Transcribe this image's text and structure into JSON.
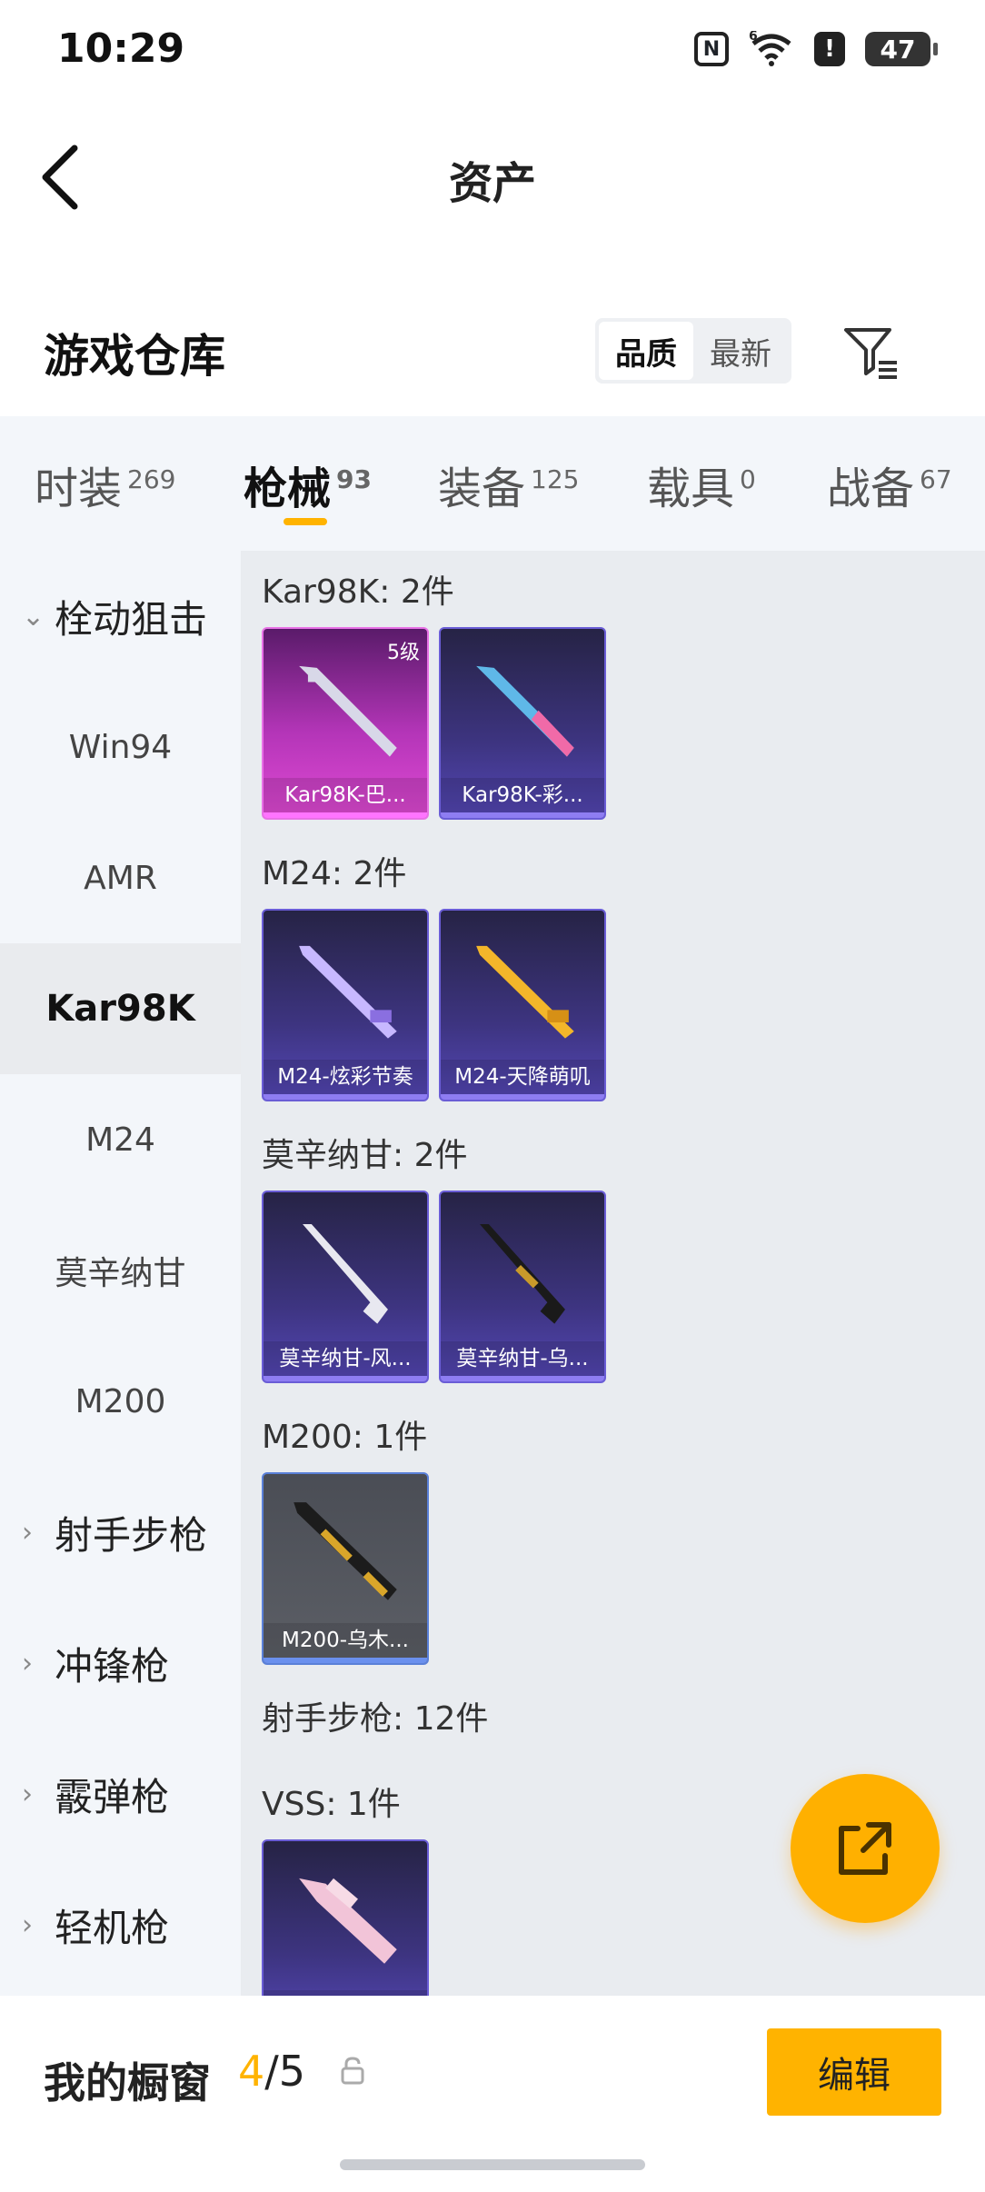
{
  "status_bar": {
    "time": "10:29",
    "network": "6",
    "battery": "47"
  },
  "header": {
    "title": "资产"
  },
  "warehouse": {
    "title": "游戏仓库",
    "sort_options": [
      "品质",
      "最新"
    ],
    "selected_sort": "品质"
  },
  "category_tabs": [
    {
      "label": "时装",
      "count": "269"
    },
    {
      "label": "枪械",
      "count": "93"
    },
    {
      "label": "装备",
      "count": "125"
    },
    {
      "label": "载具",
      "count": "0"
    },
    {
      "label": "战备",
      "count": "67"
    }
  ],
  "active_tab": "枪械",
  "sidebar": {
    "group_sniper": "栓动狙击",
    "items": [
      "Win94",
      "AMR",
      "Kar98K",
      "M24",
      "莫辛纳甘",
      "M200"
    ],
    "active_item": "Kar98K",
    "groups": [
      "射手步枪",
      "冲锋枪",
      "霰弹枪",
      "轻机枪"
    ]
  },
  "sections": [
    {
      "title": "Kar98K: 2件",
      "items": [
        {
          "name": "Kar98K-巴...",
          "badge": "5级",
          "rarity": "pink",
          "gun_color": "#d8d8e8"
        },
        {
          "name": "Kar98K-彩...",
          "badge": "",
          "rarity": "purple",
          "gun_color": "#5fb8e8"
        }
      ]
    },
    {
      "title": "M24: 2件",
      "items": [
        {
          "name": "M24-炫彩节奏",
          "badge": "",
          "rarity": "purple",
          "gun_color": "#c7b8ff"
        },
        {
          "name": "M24-天降萌叽",
          "badge": "",
          "rarity": "purple",
          "gun_color": "#f3b62a"
        }
      ]
    },
    {
      "title": "莫辛纳甘: 2件",
      "items": [
        {
          "name": "莫辛纳甘-风...",
          "badge": "",
          "rarity": "purple",
          "gun_color": "#e8e8f0"
        },
        {
          "name": "莫辛纳甘-乌...",
          "badge": "",
          "rarity": "purple",
          "gun_color": "#1a1a1a"
        }
      ]
    },
    {
      "title": "M200: 1件",
      "items": [
        {
          "name": "M200-乌木...",
          "badge": "",
          "rarity": "gray",
          "gun_color": "#d9a62a"
        }
      ]
    },
    {
      "title": "射手步枪: 12件",
      "items": []
    },
    {
      "title": "VSS: 1件",
      "items": [
        {
          "name": "",
          "badge": "",
          "rarity": "purple",
          "gun_color": "#f2c4d8"
        }
      ]
    }
  ],
  "bottom_bar": {
    "label": "我的橱窗",
    "current": "4",
    "separator": "/",
    "total": "5",
    "edit_label": "编辑"
  },
  "colors": {
    "accent": "#ffb300",
    "content_bg": "#e9ecf0",
    "sidebar_bg": "#f3f6fa"
  }
}
